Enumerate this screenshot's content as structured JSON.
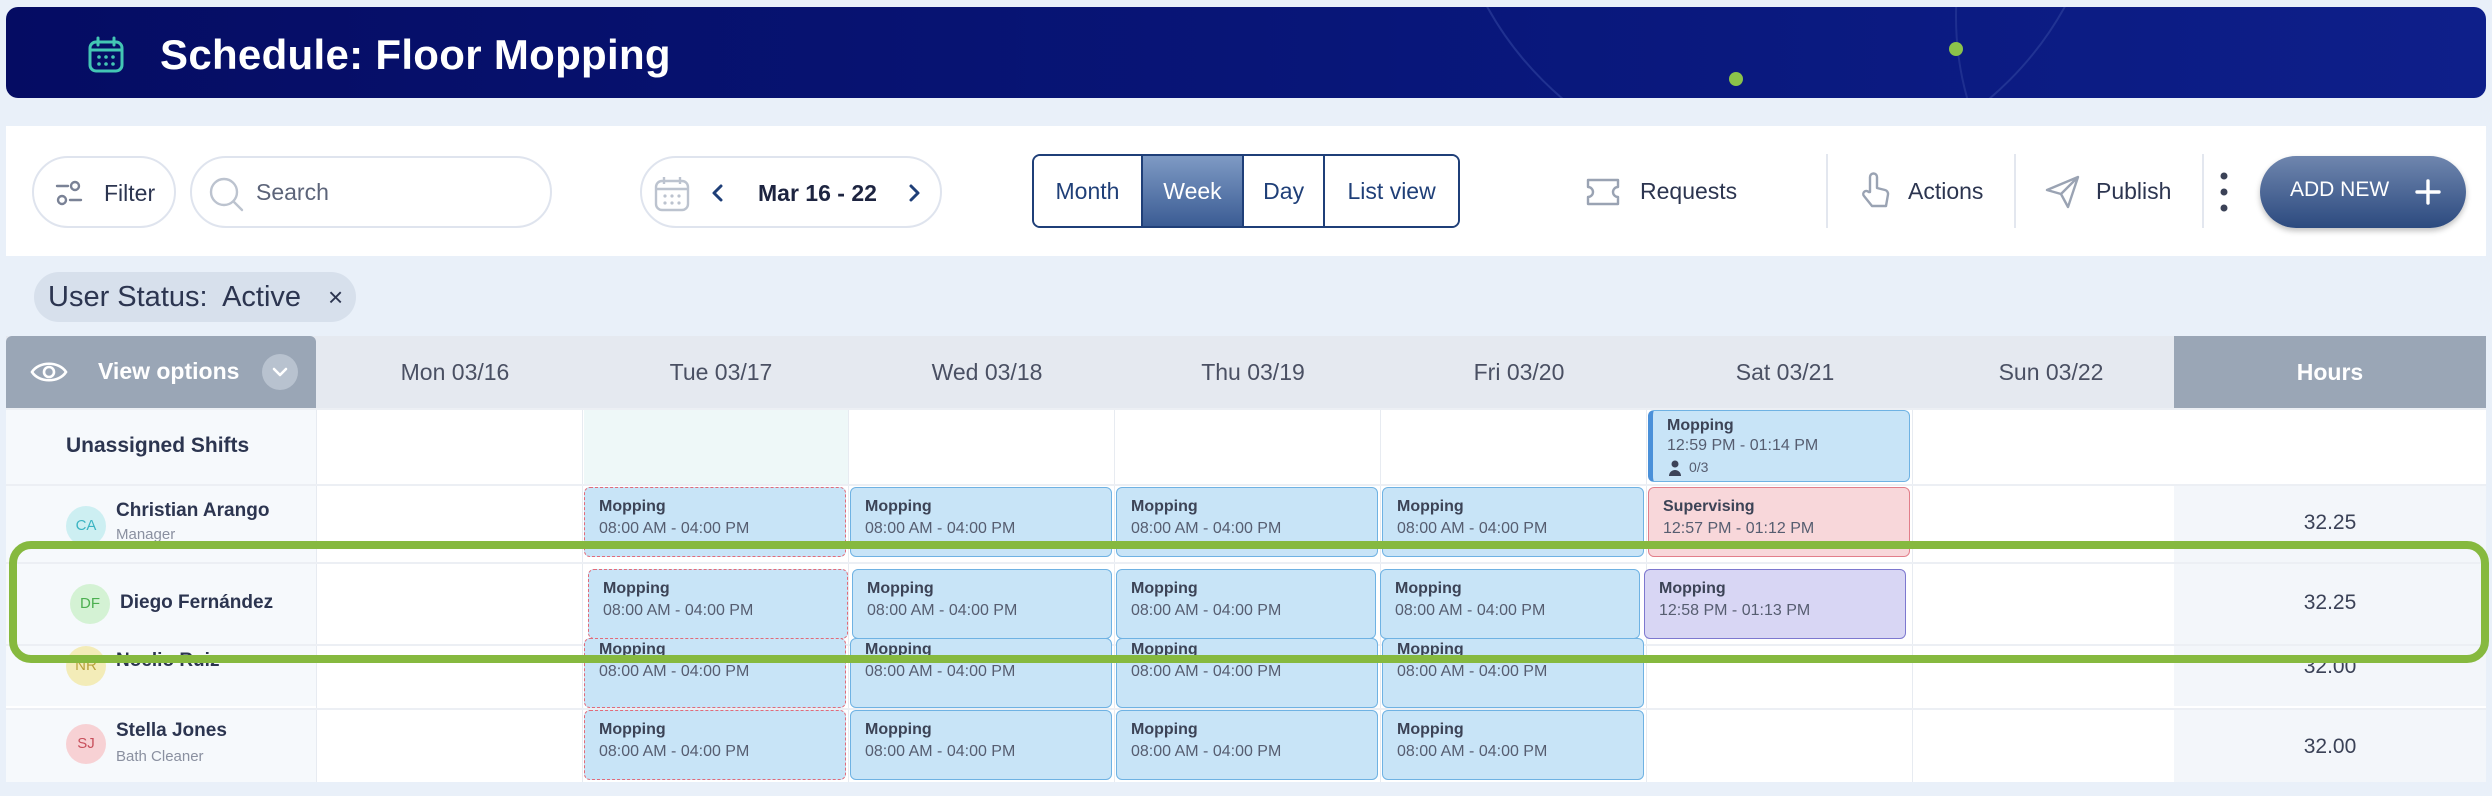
{
  "header": {
    "title": "Schedule: Floor Mopping"
  },
  "toolbar": {
    "filter_label": "Filter",
    "search_placeholder": "Search",
    "date_range": "Mar 16 - 22",
    "view_tabs": [
      {
        "label": "Month",
        "active": false
      },
      {
        "label": "Week",
        "active": true
      },
      {
        "label": "Day",
        "active": false
      },
      {
        "label": "List view",
        "active": false
      }
    ],
    "requests_label": "Requests",
    "actions_label": "Actions",
    "publish_label": "Publish",
    "add_new_label": "ADD NEW"
  },
  "filter_chip": {
    "label": "User Status:",
    "value": "Active",
    "remove": "×"
  },
  "grid": {
    "view_options_label": "View options",
    "days": [
      "Mon 03/16",
      "Tue 03/17",
      "Wed 03/18",
      "Thu 03/19",
      "Fri 03/20",
      "Sat 03/21",
      "Sun 03/22"
    ],
    "hours_label": "Hours",
    "unassigned": {
      "label": "Unassigned Shifts",
      "shift": {
        "title": "Mopping",
        "time": "12:59 PM - 01:14 PM",
        "slots": "0/3"
      }
    },
    "rows": [
      {
        "initials": "CA",
        "name": "Christian Arango",
        "role": "Manager",
        "hours": "32.25",
        "shifts": [
          {
            "title": "Mopping",
            "time": "08:00 AM - 04:00 PM"
          },
          {
            "title": "Mopping",
            "time": "08:00 AM - 04:00 PM"
          },
          {
            "title": "Mopping",
            "time": "08:00 AM - 04:00 PM"
          },
          {
            "title": "Mopping",
            "time": "08:00 AM - 04:00 PM"
          },
          {
            "title": "Supervising",
            "time": "12:57 PM - 01:12 PM"
          }
        ]
      },
      {
        "initials": "DF",
        "name": "Diego Fernández",
        "role": "",
        "hours": "32.25",
        "shifts": [
          {
            "title": "Mopping",
            "time": "08:00 AM - 04:00 PM"
          },
          {
            "title": "Mopping",
            "time": "08:00 AM - 04:00 PM"
          },
          {
            "title": "Mopping",
            "time": "08:00 AM - 04:00 PM"
          },
          {
            "title": "Mopping",
            "time": "08:00 AM - 04:00 PM"
          },
          {
            "title": "Mopping",
            "time": "12:58 PM - 01:13 PM"
          }
        ]
      },
      {
        "initials": "NR",
        "name": "Noelio Ruiz",
        "role": "",
        "hours": "32.00",
        "shifts": [
          {
            "title": "Mopping",
            "time": "08:00 AM - 04:00 PM"
          },
          {
            "title": "Mopping",
            "time": "08:00 AM - 04:00 PM"
          },
          {
            "title": "Mopping",
            "time": "08:00 AM - 04:00 PM"
          },
          {
            "title": "Mopping",
            "time": "08:00 AM - 04:00 PM"
          }
        ]
      },
      {
        "initials": "SJ",
        "name": "Stella Jones",
        "role": "Bath Cleaner",
        "hours": "32.00",
        "shifts": [
          {
            "title": "Mopping",
            "time": "08:00 AM - 04:00 PM"
          },
          {
            "title": "Mopping",
            "time": "08:00 AM - 04:00 PM"
          },
          {
            "title": "Mopping",
            "time": "08:00 AM - 04:00 PM"
          },
          {
            "title": "Mopping",
            "time": "08:00 AM - 04:00 PM"
          }
        ]
      }
    ]
  },
  "colors": {
    "header_bg": "#050c63",
    "accent": "#1f3f78",
    "shift_blue": "#c8e4f7",
    "shift_pink": "#f8d7da",
    "shift_purple": "#d8d6f4",
    "highlight": "#86b93f"
  }
}
